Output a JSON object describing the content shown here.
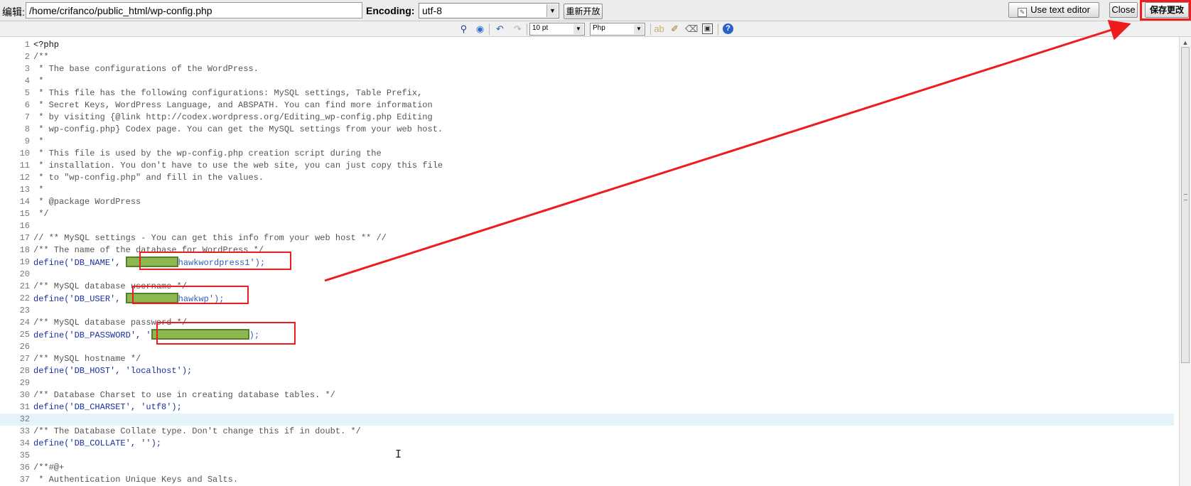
{
  "file_bar": {
    "file_label": "编辑:",
    "file_path": "/home/crifanco/public_html/wp-config.php",
    "encoding_label": "Encoding:",
    "encoding_value": "utf-8",
    "reopen_button": "重新开放",
    "text_editor_button": "Use text editor",
    "close_button": "Close",
    "save_button": "保存更改"
  },
  "toolbar": {
    "font_size": "10 pt",
    "syntax": "Php",
    "icons": [
      "find-icon",
      "find-replace-icon",
      "undo-icon",
      "redo-icon",
      "highlight-icon",
      "brush-icon",
      "eraser-icon",
      "fullscreen-icon",
      "help-icon"
    ]
  },
  "code": {
    "lines": [
      {
        "n": "1",
        "text": "<?php"
      },
      {
        "n": "2",
        "text": "/**"
      },
      {
        "n": "3",
        "text": " * The base configurations of the WordPress."
      },
      {
        "n": "4",
        "text": " *"
      },
      {
        "n": "5",
        "text": " * This file has the following configurations: MySQL settings, Table Prefix,"
      },
      {
        "n": "6",
        "text": " * Secret Keys, WordPress Language, and ABSPATH. You can find more information"
      },
      {
        "n": "7",
        "text": " * by visiting {@link http://codex.wordpress.org/Editing_wp-config.php Editing"
      },
      {
        "n": "8",
        "text": " * wp-config.php} Codex page. You can get the MySQL settings from your web host."
      },
      {
        "n": "9",
        "text": " *"
      },
      {
        "n": "10",
        "text": " * This file is used by the wp-config.php creation script during the"
      },
      {
        "n": "11",
        "text": " * installation. You don't have to use the web site, you can just copy this file"
      },
      {
        "n": "12",
        "text": " * to \"wp-config.php\" and fill in the values."
      },
      {
        "n": "13",
        "text": " *"
      },
      {
        "n": "14",
        "text": " * @package WordPress"
      },
      {
        "n": "15",
        "text": " */"
      },
      {
        "n": "16",
        "text": ""
      },
      {
        "n": "17",
        "text": "// ** MySQL settings - You can get this info from your web host ** //"
      },
      {
        "n": "18",
        "text": "/** The name of the database for WordPress */"
      },
      {
        "n": "19",
        "pre": "define('DB_NAME', ",
        "post": "hawkwordpress1');"
      },
      {
        "n": "20",
        "text": ""
      },
      {
        "n": "21",
        "text": "/** MySQL database username */"
      },
      {
        "n": "22",
        "pre": "define('DB_USER', ",
        "post": "hawkwp');"
      },
      {
        "n": "23",
        "text": ""
      },
      {
        "n": "24",
        "text": "/** MySQL database password */"
      },
      {
        "n": "25",
        "pre": "define('DB_PASSWORD', '",
        "post": ");"
      },
      {
        "n": "26",
        "text": ""
      },
      {
        "n": "27",
        "text": "/** MySQL hostname */"
      },
      {
        "n": "28",
        "text": "define('DB_HOST', 'localhost');"
      },
      {
        "n": "29",
        "text": ""
      },
      {
        "n": "30",
        "text": "/** Database Charset to use in creating database tables. */"
      },
      {
        "n": "31",
        "text": "define('DB_CHARSET', 'utf8');"
      },
      {
        "n": "32",
        "text": ""
      },
      {
        "n": "33",
        "text": "/** The Database Collate type. Don't change this if in doubt. */"
      },
      {
        "n": "34",
        "text": "define('DB_COLLATE', '');"
      },
      {
        "n": "35",
        "text": ""
      },
      {
        "n": "36",
        "text": "/**#@+"
      },
      {
        "n": "37",
        "text": " * Authentication Unique Keys and Salts."
      }
    ],
    "active_line": "32"
  },
  "colors": {
    "highlight_red": "#ee1c1c",
    "mask_green": "#8db84f",
    "keyword_blue": "#1a2fa0",
    "active_line_bg": "#e4f2fa"
  }
}
